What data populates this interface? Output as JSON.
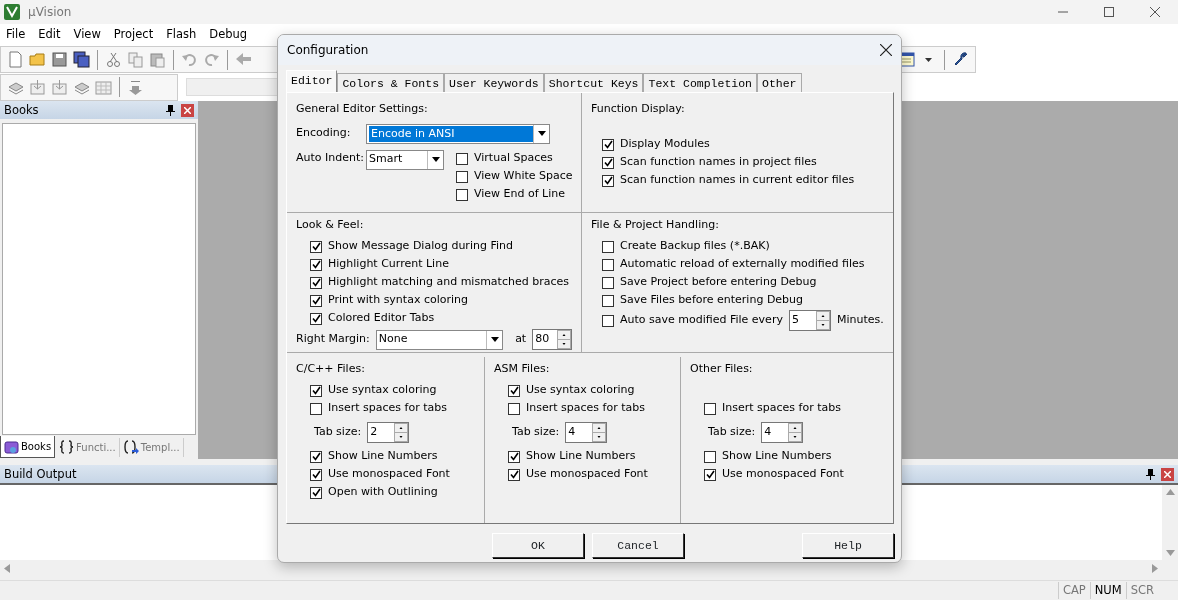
{
  "window": {
    "title": "µVision"
  },
  "menu": [
    "File",
    "Edit",
    "View",
    "Project",
    "Flash",
    "Debug"
  ],
  "books_panel": {
    "title": "Books",
    "tabs": [
      {
        "label": "Books",
        "selected": true
      },
      {
        "label": "Functi...",
        "selected": false
      },
      {
        "label": "Templ...",
        "selected": false
      }
    ]
  },
  "build_output": {
    "title": "Build Output"
  },
  "status_bar": {
    "indicators": [
      {
        "label": "CAP",
        "on": false
      },
      {
        "label": "NUM",
        "on": true
      },
      {
        "label": "SCR",
        "on": false
      }
    ]
  },
  "dialog": {
    "title": "Configuration",
    "tabs": [
      {
        "label": "Editor",
        "selected": true
      },
      {
        "label": "Colors & Fonts",
        "selected": false
      },
      {
        "label": "User Keywords",
        "selected": false
      },
      {
        "label": "Shortcut Keys",
        "selected": false
      },
      {
        "label": "Text Completion",
        "selected": false
      },
      {
        "label": "Other",
        "selected": false
      }
    ],
    "general": {
      "heading": "General Editor Settings:",
      "encoding": {
        "label": "Encoding:",
        "value": "Encode in ANSI"
      },
      "auto_indent": {
        "label": "Auto Indent:",
        "value": "Smart"
      },
      "checks": [
        {
          "label": "Virtual Spaces",
          "checked": false
        },
        {
          "label": "View White Space",
          "checked": false
        },
        {
          "label": "View End of Line",
          "checked": false
        }
      ]
    },
    "function_display": {
      "heading": "Function Display:",
      "checks": [
        {
          "label": "Display Modules",
          "checked": true
        },
        {
          "label": "Scan function names in project files",
          "checked": true
        },
        {
          "label": "Scan function names in current editor files",
          "checked": true
        }
      ]
    },
    "look_feel": {
      "heading": "Look & Feel:",
      "checks": [
        {
          "label": "Show Message Dialog during Find",
          "checked": true
        },
        {
          "label": "Highlight Current Line",
          "checked": true
        },
        {
          "label": "Highlight matching and mismatched braces",
          "checked": true
        },
        {
          "label": "Print with syntax coloring",
          "checked": true
        },
        {
          "label": "Colored Editor Tabs",
          "checked": true
        }
      ],
      "right_margin": {
        "label": "Right Margin:",
        "value": "None",
        "at_label": "at",
        "at_value": "80"
      }
    },
    "file_project": {
      "heading": "File & Project Handling:",
      "checks": [
        {
          "label": "Create Backup files (*.BAK)",
          "checked": false
        },
        {
          "label": "Automatic reload of externally modified files",
          "checked": false
        },
        {
          "label": "Save Project before entering Debug",
          "checked": false
        },
        {
          "label": "Save Files before entering Debug",
          "checked": false
        },
        {
          "label": "Auto save modified File every",
          "checked": false,
          "value": "5",
          "suffix": "Minutes."
        }
      ]
    },
    "file_groups": [
      {
        "heading": "C/C++ Files:",
        "items": [
          {
            "kind": "check",
            "label": "Use syntax coloring",
            "checked": true
          },
          {
            "kind": "check",
            "label": "Insert spaces for tabs",
            "checked": false
          },
          {
            "kind": "tabsize",
            "label": "Tab size:",
            "value": "2"
          },
          {
            "kind": "check",
            "label": "Show Line Numbers",
            "checked": true
          },
          {
            "kind": "check",
            "label": "Use monospaced Font",
            "checked": true
          },
          {
            "kind": "check",
            "label": "Open with Outlining",
            "checked": true
          }
        ]
      },
      {
        "heading": "ASM Files:",
        "items": [
          {
            "kind": "check",
            "label": "Use syntax coloring",
            "checked": true
          },
          {
            "kind": "check",
            "label": "Insert spaces for tabs",
            "checked": false
          },
          {
            "kind": "tabsize",
            "label": "Tab size:",
            "value": "4"
          },
          {
            "kind": "check",
            "label": "Show Line Numbers",
            "checked": true
          },
          {
            "kind": "check",
            "label": "Use monospaced Font",
            "checked": true
          }
        ]
      },
      {
        "heading": "Other Files:",
        "items": [
          {
            "kind": "blank"
          },
          {
            "kind": "check",
            "label": "Insert spaces for tabs",
            "checked": false
          },
          {
            "kind": "tabsize",
            "label": "Tab size:",
            "value": "4"
          },
          {
            "kind": "check",
            "label": "Show Line Numbers",
            "checked": false
          },
          {
            "kind": "check",
            "label": "Use monospaced Font",
            "checked": true
          }
        ]
      }
    ],
    "buttons": [
      {
        "label": "OK",
        "kind": "left"
      },
      {
        "label": "Cancel",
        "kind": "left"
      },
      {
        "label": "Help",
        "kind": "right"
      }
    ]
  }
}
